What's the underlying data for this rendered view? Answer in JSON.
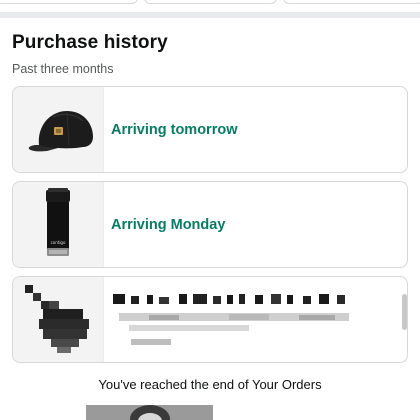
{
  "section": {
    "title": "Purchase history",
    "subtitle": "Past three months"
  },
  "orders": [
    {
      "status": "Arriving tomorrow",
      "item_icon": "baseball-cap"
    },
    {
      "status": "Arriving Monday",
      "item_icon": "travel-tumbler"
    },
    {
      "status": "",
      "item_icon": "pixelated-item"
    }
  ],
  "footer": {
    "end_message": "You've reached the end of Your Orders"
  },
  "colors": {
    "status_green": "#067d62",
    "card_border": "#d5d9d9",
    "divider": "#e7e9ec"
  }
}
